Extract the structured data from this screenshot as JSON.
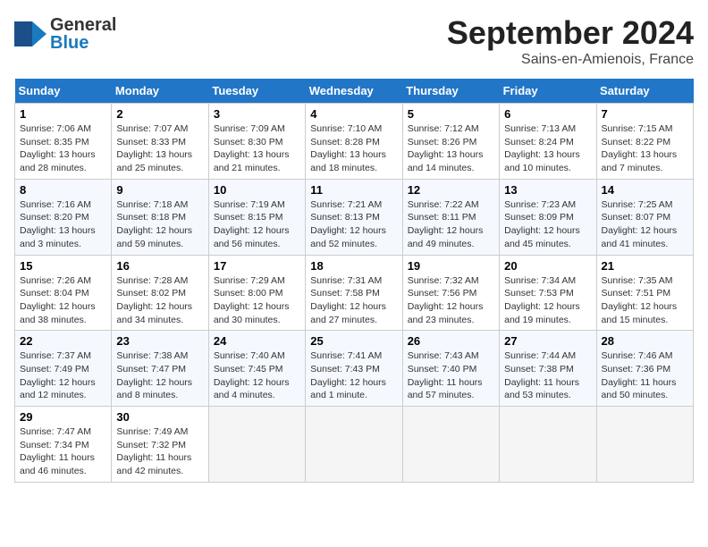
{
  "header": {
    "logo": {
      "general": "General",
      "blue": "Blue"
    },
    "title": "September 2024",
    "subtitle": "Sains-en-Amienois, France"
  },
  "weekdays": [
    "Sunday",
    "Monday",
    "Tuesday",
    "Wednesday",
    "Thursday",
    "Friday",
    "Saturday"
  ],
  "weeks": [
    [
      {
        "day": "1",
        "sunrise": "Sunrise: 7:06 AM",
        "sunset": "Sunset: 8:35 PM",
        "daylight": "Daylight: 13 hours and 28 minutes."
      },
      {
        "day": "2",
        "sunrise": "Sunrise: 7:07 AM",
        "sunset": "Sunset: 8:33 PM",
        "daylight": "Daylight: 13 hours and 25 minutes."
      },
      {
        "day": "3",
        "sunrise": "Sunrise: 7:09 AM",
        "sunset": "Sunset: 8:30 PM",
        "daylight": "Daylight: 13 hours and 21 minutes."
      },
      {
        "day": "4",
        "sunrise": "Sunrise: 7:10 AM",
        "sunset": "Sunset: 8:28 PM",
        "daylight": "Daylight: 13 hours and 18 minutes."
      },
      {
        "day": "5",
        "sunrise": "Sunrise: 7:12 AM",
        "sunset": "Sunset: 8:26 PM",
        "daylight": "Daylight: 13 hours and 14 minutes."
      },
      {
        "day": "6",
        "sunrise": "Sunrise: 7:13 AM",
        "sunset": "Sunset: 8:24 PM",
        "daylight": "Daylight: 13 hours and 10 minutes."
      },
      {
        "day": "7",
        "sunrise": "Sunrise: 7:15 AM",
        "sunset": "Sunset: 8:22 PM",
        "daylight": "Daylight: 13 hours and 7 minutes."
      }
    ],
    [
      {
        "day": "8",
        "sunrise": "Sunrise: 7:16 AM",
        "sunset": "Sunset: 8:20 PM",
        "daylight": "Daylight: 13 hours and 3 minutes."
      },
      {
        "day": "9",
        "sunrise": "Sunrise: 7:18 AM",
        "sunset": "Sunset: 8:18 PM",
        "daylight": "Daylight: 12 hours and 59 minutes."
      },
      {
        "day": "10",
        "sunrise": "Sunrise: 7:19 AM",
        "sunset": "Sunset: 8:15 PM",
        "daylight": "Daylight: 12 hours and 56 minutes."
      },
      {
        "day": "11",
        "sunrise": "Sunrise: 7:21 AM",
        "sunset": "Sunset: 8:13 PM",
        "daylight": "Daylight: 12 hours and 52 minutes."
      },
      {
        "day": "12",
        "sunrise": "Sunrise: 7:22 AM",
        "sunset": "Sunset: 8:11 PM",
        "daylight": "Daylight: 12 hours and 49 minutes."
      },
      {
        "day": "13",
        "sunrise": "Sunrise: 7:23 AM",
        "sunset": "Sunset: 8:09 PM",
        "daylight": "Daylight: 12 hours and 45 minutes."
      },
      {
        "day": "14",
        "sunrise": "Sunrise: 7:25 AM",
        "sunset": "Sunset: 8:07 PM",
        "daylight": "Daylight: 12 hours and 41 minutes."
      }
    ],
    [
      {
        "day": "15",
        "sunrise": "Sunrise: 7:26 AM",
        "sunset": "Sunset: 8:04 PM",
        "daylight": "Daylight: 12 hours and 38 minutes."
      },
      {
        "day": "16",
        "sunrise": "Sunrise: 7:28 AM",
        "sunset": "Sunset: 8:02 PM",
        "daylight": "Daylight: 12 hours and 34 minutes."
      },
      {
        "day": "17",
        "sunrise": "Sunrise: 7:29 AM",
        "sunset": "Sunset: 8:00 PM",
        "daylight": "Daylight: 12 hours and 30 minutes."
      },
      {
        "day": "18",
        "sunrise": "Sunrise: 7:31 AM",
        "sunset": "Sunset: 7:58 PM",
        "daylight": "Daylight: 12 hours and 27 minutes."
      },
      {
        "day": "19",
        "sunrise": "Sunrise: 7:32 AM",
        "sunset": "Sunset: 7:56 PM",
        "daylight": "Daylight: 12 hours and 23 minutes."
      },
      {
        "day": "20",
        "sunrise": "Sunrise: 7:34 AM",
        "sunset": "Sunset: 7:53 PM",
        "daylight": "Daylight: 12 hours and 19 minutes."
      },
      {
        "day": "21",
        "sunrise": "Sunrise: 7:35 AM",
        "sunset": "Sunset: 7:51 PM",
        "daylight": "Daylight: 12 hours and 15 minutes."
      }
    ],
    [
      {
        "day": "22",
        "sunrise": "Sunrise: 7:37 AM",
        "sunset": "Sunset: 7:49 PM",
        "daylight": "Daylight: 12 hours and 12 minutes."
      },
      {
        "day": "23",
        "sunrise": "Sunrise: 7:38 AM",
        "sunset": "Sunset: 7:47 PM",
        "daylight": "Daylight: 12 hours and 8 minutes."
      },
      {
        "day": "24",
        "sunrise": "Sunrise: 7:40 AM",
        "sunset": "Sunset: 7:45 PM",
        "daylight": "Daylight: 12 hours and 4 minutes."
      },
      {
        "day": "25",
        "sunrise": "Sunrise: 7:41 AM",
        "sunset": "Sunset: 7:43 PM",
        "daylight": "Daylight: 12 hours and 1 minute."
      },
      {
        "day": "26",
        "sunrise": "Sunrise: 7:43 AM",
        "sunset": "Sunset: 7:40 PM",
        "daylight": "Daylight: 11 hours and 57 minutes."
      },
      {
        "day": "27",
        "sunrise": "Sunrise: 7:44 AM",
        "sunset": "Sunset: 7:38 PM",
        "daylight": "Daylight: 11 hours and 53 minutes."
      },
      {
        "day": "28",
        "sunrise": "Sunrise: 7:46 AM",
        "sunset": "Sunset: 7:36 PM",
        "daylight": "Daylight: 11 hours and 50 minutes."
      }
    ],
    [
      {
        "day": "29",
        "sunrise": "Sunrise: 7:47 AM",
        "sunset": "Sunset: 7:34 PM",
        "daylight": "Daylight: 11 hours and 46 minutes."
      },
      {
        "day": "30",
        "sunrise": "Sunrise: 7:49 AM",
        "sunset": "Sunset: 7:32 PM",
        "daylight": "Daylight: 11 hours and 42 minutes."
      },
      null,
      null,
      null,
      null,
      null
    ]
  ]
}
